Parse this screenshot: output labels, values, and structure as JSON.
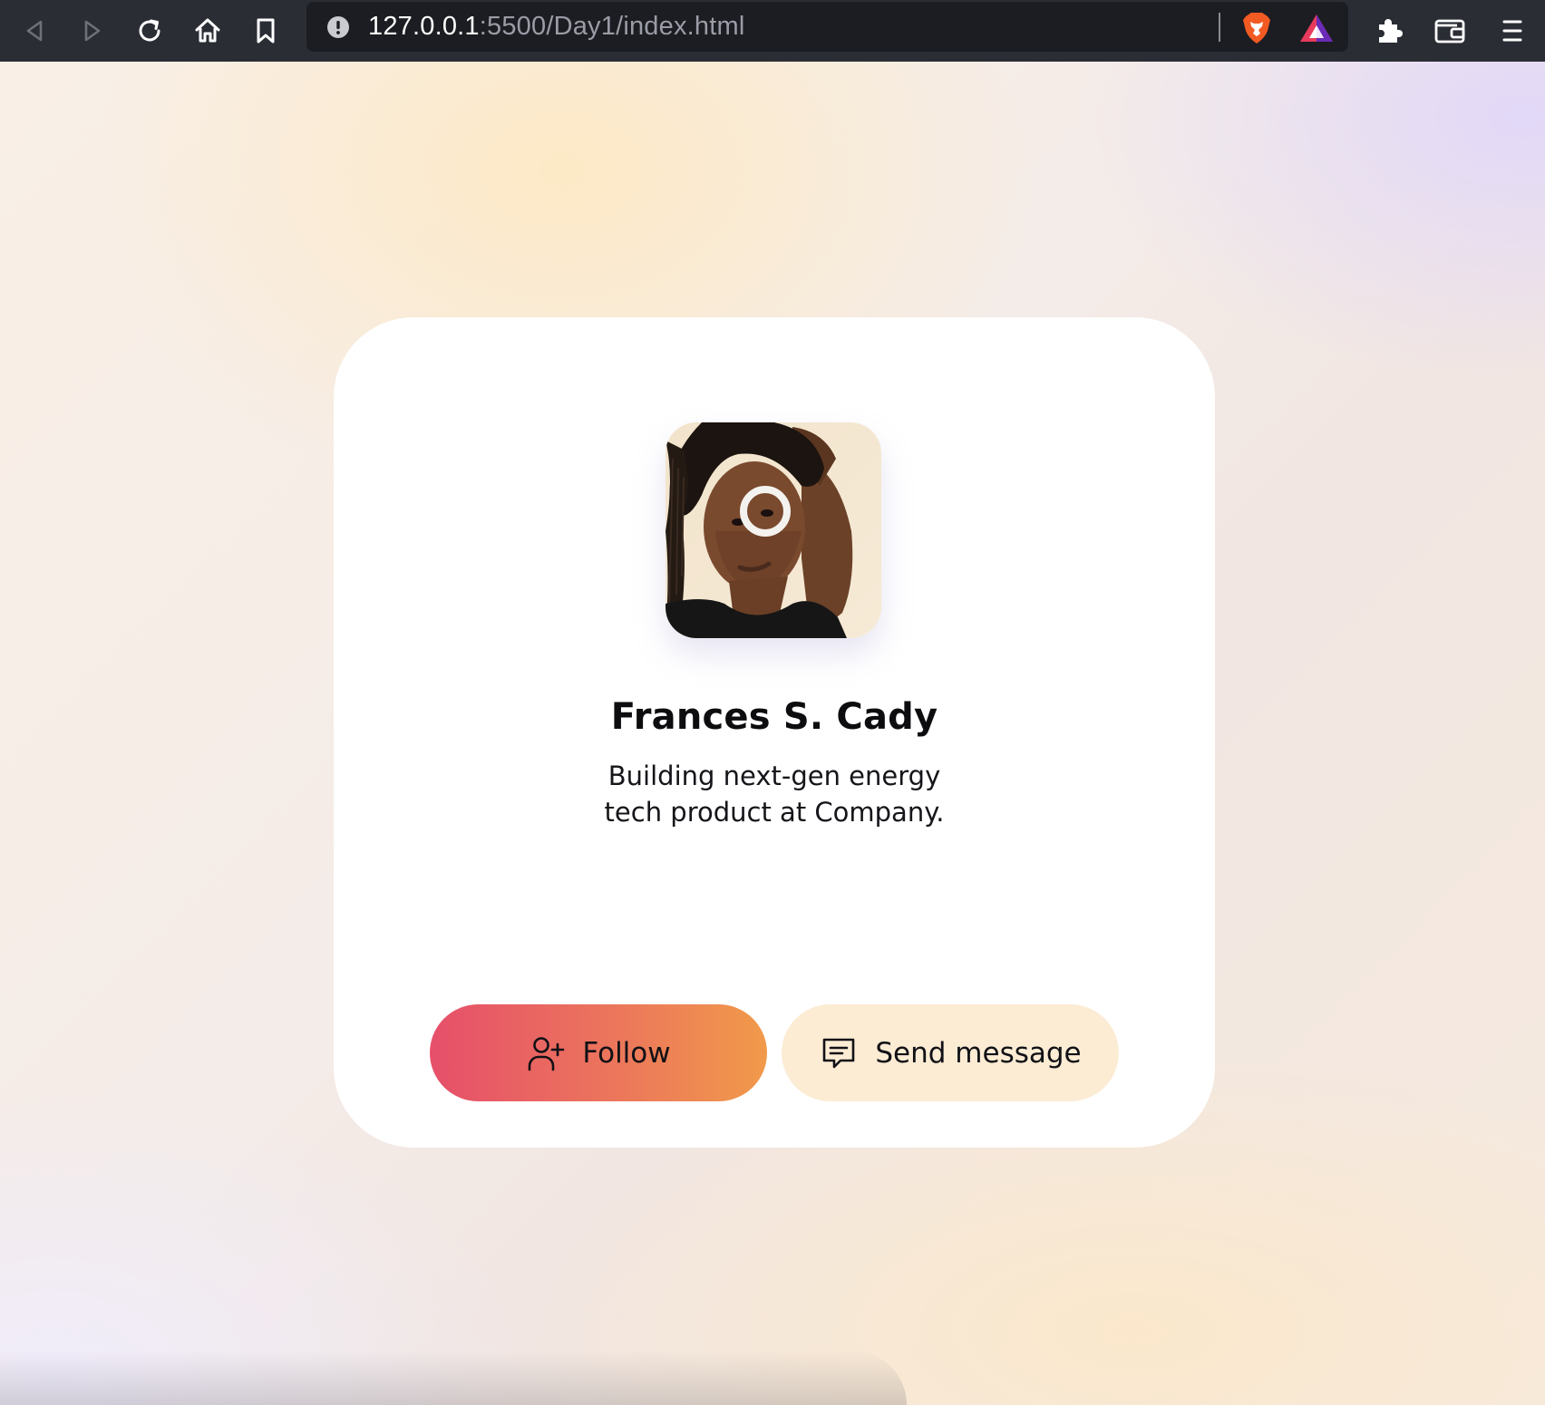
{
  "browser": {
    "url_host": "127.0.0.1",
    "url_rest": ":5500/Day1/index.html",
    "toolbar_icons": [
      "back-icon",
      "forward-icon",
      "reload-icon",
      "home-icon",
      "bookmark-icon",
      "site-info-icon",
      "brave-shields-icon",
      "brave-rewards-icon",
      "extensions-icon",
      "wallet-icon",
      "menu-icon"
    ]
  },
  "profile": {
    "name": "Frances S. Cady",
    "bio_line1": "Building next-gen energy",
    "bio_line2": "tech product at Company.",
    "avatar_alt": "Profile photo"
  },
  "actions": {
    "follow_label": "Follow",
    "message_label": "Send message"
  },
  "colors": {
    "follow_gradient_start": "#e64f6a",
    "follow_gradient_end": "#f19a4a",
    "message_bg": "#fcecd4",
    "card_bg": "#ffffff",
    "chrome_bg": "#2b2d35"
  }
}
